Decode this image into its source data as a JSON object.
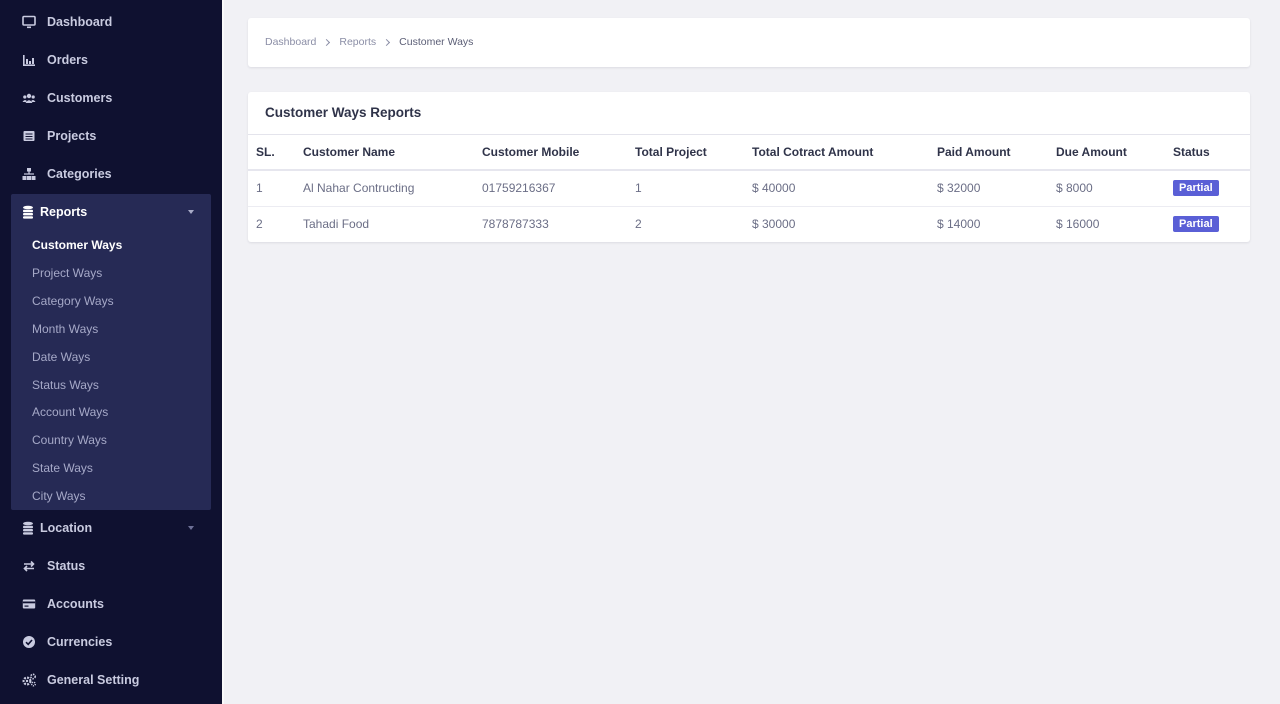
{
  "sidebar": {
    "items_top": [
      {
        "label": "Dashboard",
        "icon": "monitor-icon"
      },
      {
        "label": "Orders",
        "icon": "bar-chart-icon"
      },
      {
        "label": "Customers",
        "icon": "users-icon"
      },
      {
        "label": "Projects",
        "icon": "list-icon"
      },
      {
        "label": "Categories",
        "icon": "sitemap-icon"
      }
    ],
    "reports": {
      "label": "Reports",
      "icon": "database-icon",
      "subitems": [
        {
          "label": "Customer Ways",
          "active": true
        },
        {
          "label": "Project Ways"
        },
        {
          "label": "Category Ways"
        },
        {
          "label": "Month Ways"
        },
        {
          "label": "Date Ways"
        },
        {
          "label": "Status Ways"
        },
        {
          "label": "Account Ways"
        },
        {
          "label": "Country Ways"
        },
        {
          "label": "State Ways"
        },
        {
          "label": "City Ways"
        }
      ]
    },
    "location": {
      "label": "Location",
      "icon": "database-icon"
    },
    "items_bottom": [
      {
        "label": "Status",
        "icon": "exchange-icon"
      },
      {
        "label": "Accounts",
        "icon": "credit-card-icon"
      },
      {
        "label": "Currencies",
        "icon": "check-circle-icon"
      },
      {
        "label": "General Setting",
        "icon": "gears-icon"
      }
    ]
  },
  "breadcrumb": [
    "Dashboard",
    "Reports",
    "Customer Ways"
  ],
  "report": {
    "title": "Customer Ways Reports",
    "columns": [
      "SL.",
      "Customer Name",
      "Customer Mobile",
      "Total Project",
      "Total Cotract Amount",
      "Paid Amount",
      "Due Amount",
      "Status"
    ],
    "rows": [
      [
        "1",
        "Al Nahar Contructing",
        "01759216367",
        "1",
        "$ 40000",
        "$ 32000",
        "$ 8000",
        "Partial"
      ],
      [
        "2",
        "Tahadi Food",
        "7878787333",
        "2",
        "$ 30000",
        "$ 14000",
        "$ 16000",
        "Partial"
      ]
    ]
  },
  "colors": {
    "sidebar_bg": "#0f1130",
    "reports_group_bg": "#262a55",
    "badge_bg": "#5a5fd6",
    "page_bg": "#f1f1f5"
  }
}
